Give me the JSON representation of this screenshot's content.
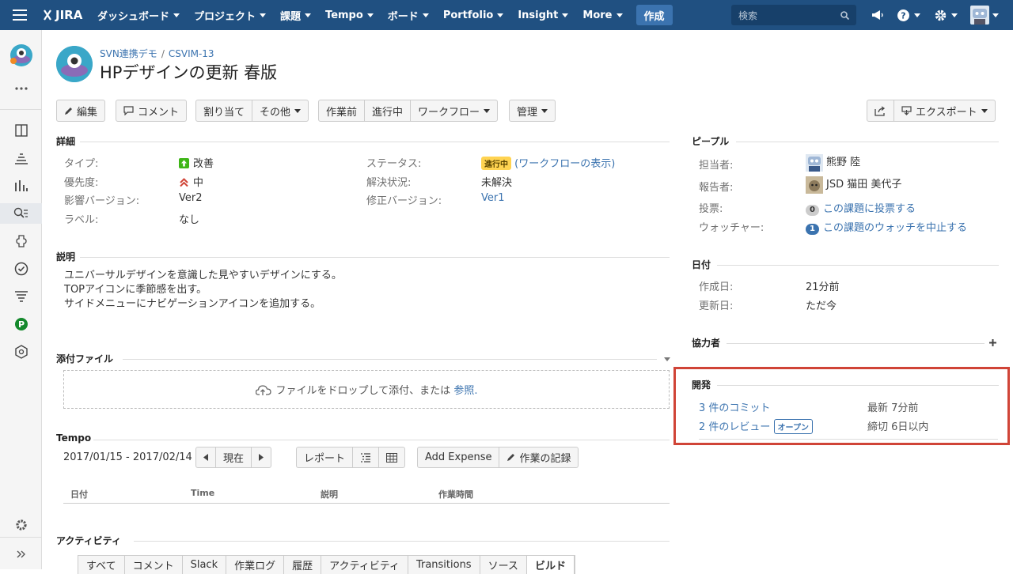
{
  "topbar": {
    "logo": "JIRA",
    "menu": [
      "ダッシュボード",
      "プロジェクト",
      "課題",
      "Tempo",
      "ボード",
      "Portfolio",
      "Insight",
      "More"
    ],
    "create_label": "作成",
    "search_placeholder": "検索"
  },
  "breadcrumb": {
    "project": "SVN連携デモ",
    "separator": "/",
    "issue_key": "CSVIM-13"
  },
  "issue_title": "HPデザインの更新 春版",
  "toolbar": {
    "edit": "編集",
    "comment": "コメント",
    "assign": "割り当て",
    "more": "その他",
    "prev_state": "作業前",
    "in_progress": "進行中",
    "workflow": "ワークフロー",
    "admin": "管理",
    "export": "エクスポート"
  },
  "details": {
    "heading": "詳細",
    "type_label": "タイプ:",
    "type_value": "改善",
    "priority_label": "優先度:",
    "priority_value": "中",
    "affects_label": "影響バージョン:",
    "affects_value": "Ver2",
    "labels_label": "ラベル:",
    "labels_value": "なし",
    "status_label": "ステータス:",
    "status_value": "進行中",
    "status_link": "(ワークフローの表示)",
    "resolution_label": "解決状況:",
    "resolution_value": "未解決",
    "fix_label": "修正バージョン:",
    "fix_value": "Ver1"
  },
  "description": {
    "heading": "説明",
    "lines": [
      "ユニバーサルデザインを意識した見やすいデザインにする。",
      "TOPアイコンに季節感を出す。",
      "サイドメニューにナビゲーションアイコンを追加する。"
    ]
  },
  "attachments": {
    "heading": "添付ファイル",
    "drop_text": "ファイルをドロップして添付、または",
    "browse_link": "参照."
  },
  "tempo": {
    "heading": "Tempo",
    "date_range": "2017/01/15 - 2017/02/14",
    "current": "現在",
    "report": "レポート",
    "add_expense": "Add Expense",
    "log_work": "作業の記録",
    "columns": [
      "日付",
      "Time",
      "説明",
      "作業時間"
    ]
  },
  "activity": {
    "heading": "アクティビティ",
    "tabs": [
      "すべて",
      "コメント",
      "Slack",
      "作業ログ",
      "履歴",
      "アクティビティ",
      "Transitions",
      "ソース",
      "ビルド"
    ]
  },
  "people": {
    "heading": "ピープル",
    "assignee_label": "担当者:",
    "assignee": "熊野 陸",
    "reporter_label": "報告者:",
    "reporter": "JSD 猫田 美代子",
    "votes_label": "投票:",
    "votes_count": "0",
    "votes_link": "この課題に投票する",
    "watchers_label": "ウォッチャー:",
    "watchers_count": "1",
    "watchers_link": "この課題のウォッチを中止する"
  },
  "dates": {
    "heading": "日付",
    "created_label": "作成日:",
    "created": "21分前",
    "updated_label": "更新日:",
    "updated": "ただ今"
  },
  "collaborators": {
    "heading": "協力者"
  },
  "development": {
    "heading": "開発",
    "commits": "3 件のコミット",
    "commits_meta": "最新 7分前",
    "reviews": "2 件のレビュー",
    "reviews_badge": "オープン",
    "reviews_meta": "締切 6日以内"
  },
  "colors": {
    "topbar": "#205081",
    "link": "#3b73af",
    "highlight": "#d04437",
    "status": "#ffd351"
  }
}
